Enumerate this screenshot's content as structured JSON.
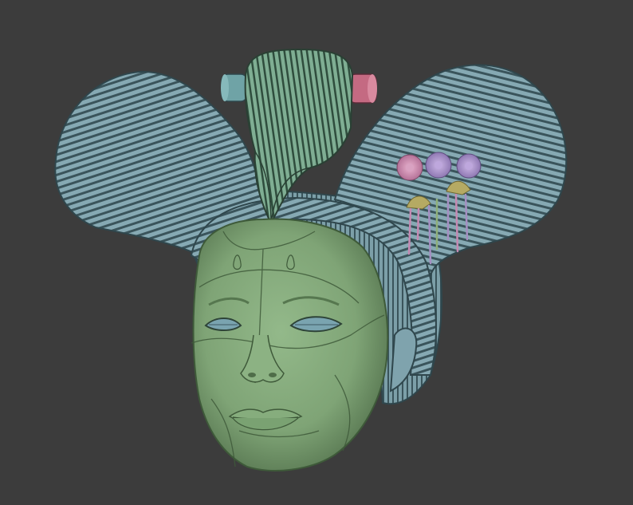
{
  "scene": {
    "subject": "",
    "background_color": "#3c3c3c",
    "colors": {
      "hair": "#7fa3ad",
      "hair_dark": "#2f464c",
      "topknot": "#7aa88f",
      "skin": "#7fa476",
      "skin_shadow": "#4f6d49",
      "pin_teal": "#6fa3a6",
      "pin_pink": "#c46a82",
      "flower_pink": "#c58ab3",
      "flower_lilac": "#a58fc2",
      "ornament_gold": "#b5aa63"
    }
  }
}
